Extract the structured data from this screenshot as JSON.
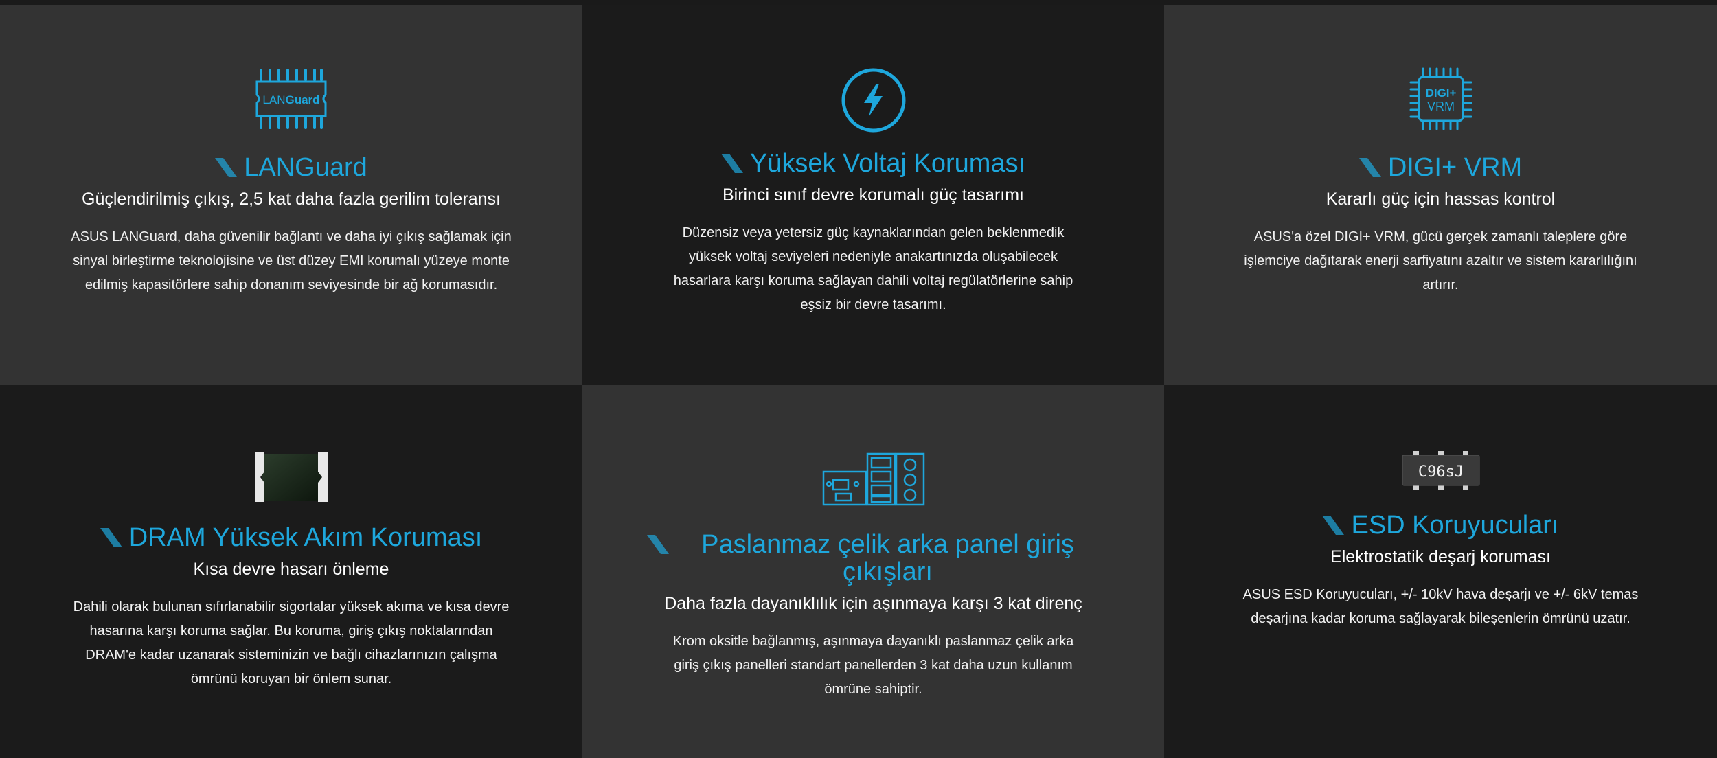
{
  "features": [
    {
      "title": "LANGuard",
      "subtitle": "Güçlendirilmiş çıkış, 2,5 kat daha fazla gerilim toleransı",
      "description": "ASUS LANGuard, daha güvenilir bağlantı ve daha iyi çıkış sağlamak için sinyal birleştirme teknolojisine ve üst düzey EMI korumalı yüzeye monte edilmiş kapasitörlere sahip donanım seviyesinde bir ağ korumasıdır.",
      "icon": "languard-chip-icon",
      "icon_text_a": "LAN",
      "icon_text_b": "Guard"
    },
    {
      "title": "Yüksek Voltaj Koruması",
      "subtitle": "Birinci sınıf devre korumalı güç tasarımı",
      "description": "Düzensiz veya yetersiz güç kaynaklarından gelen beklenmedik yüksek voltaj seviyeleri nedeniyle anakartınızda oluşabilecek hasarlara karşı koruma sağlayan dahili voltaj regülatörlerine sahip eşsiz bir devre tasarımı.",
      "icon": "lightning-bolt-icon"
    },
    {
      "title": "DIGI+ VRM",
      "subtitle": "Kararlı güç için hassas kontrol",
      "description": "ASUS'a özel DIGI+ VRM, gücü gerçek zamanlı taleplere göre işlemciye dağıtarak enerji sarfiyatını azaltır ve sistem kararlılığını artırır.",
      "icon": "digi-vrm-chip-icon",
      "icon_text_a": "DIGI+",
      "icon_text_b": "VRM"
    },
    {
      "title": "DRAM Yüksek Akım Koruması",
      "subtitle": "Kısa devre hasarı önleme",
      "description": "Dahili olarak bulunan sıfırlanabilir sigortalar yüksek akıma ve kısa devre hasarına karşı koruma sağlar. Bu koruma, giriş çıkış noktalarından DRAM'e kadar uzanarak sisteminizin ve bağlı cihazlarınızın çalışma ömrünü koruyan bir önlem sunar.",
      "icon": "fuse-component-icon"
    },
    {
      "title": "Paslanmaz çelik arka panel giriş çıkışları",
      "subtitle": "Daha fazla dayanıklılık için aşınmaya karşı 3 kat direnç",
      "description": "Krom oksitle bağlanmış, aşınmaya dayanıklı paslanmaz çelik arka giriş çıkış panelleri standart panellerden 3 kat daha uzun kullanım ömrüne sahiptir.",
      "icon": "io-panel-icon"
    },
    {
      "title": "ESD Koruyucuları",
      "subtitle": "Elektrostatik deşarj koruması",
      "description": "ASUS ESD Koruyucuları, +/- 10kV hava deşarjı ve +/- 6kV temas deşarjına kadar koruma sağlayarak bileşenlerin ömrünü uzatır.",
      "icon": "esd-chip-icon",
      "icon_text_a": "C96sJ"
    }
  ],
  "colors": {
    "accent": "#1ea7dc",
    "cell_light": "#333333",
    "cell_dark": "#1b1b1b"
  }
}
